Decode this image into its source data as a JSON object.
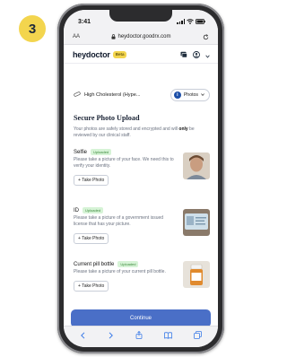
{
  "step_number": "3",
  "status_bar": {
    "time": "3:41"
  },
  "browser": {
    "aa": "AA",
    "url": "heydoctor.goodrx.com"
  },
  "header": {
    "logo": "heydoctor",
    "badge": "Beta"
  },
  "case": {
    "label": "High Cholesterol (Hype...",
    "select_value": "Photos",
    "select_icon": "i"
  },
  "upload": {
    "title": "Secure Photo Upload",
    "intro_start": "Your photos are safely stored and encrypted and will ",
    "intro_bold": "only",
    "intro_end": " be reviewed by our clinical staff.",
    "items": [
      {
        "title": "Selfie",
        "badge": "Uploaded",
        "desc": "Please take a picture of your face. We need this to verify your identity.",
        "button": "+ Take Photo"
      },
      {
        "title": "ID",
        "badge": "Uploaded",
        "desc": "Please take a picture of a government issued license that has your picture.",
        "button": "+ Take Photo"
      },
      {
        "title": "Current pill bottle",
        "badge": "Uploaded",
        "desc": "Please take a picture of your current pill bottle.",
        "button": "+ Take Photo"
      }
    ]
  },
  "continue_label": "Continue",
  "colors": {
    "accent": "#4a6fc7",
    "brand_yellow": "#f3d54e",
    "uploaded_green": "#d6f3d6"
  }
}
